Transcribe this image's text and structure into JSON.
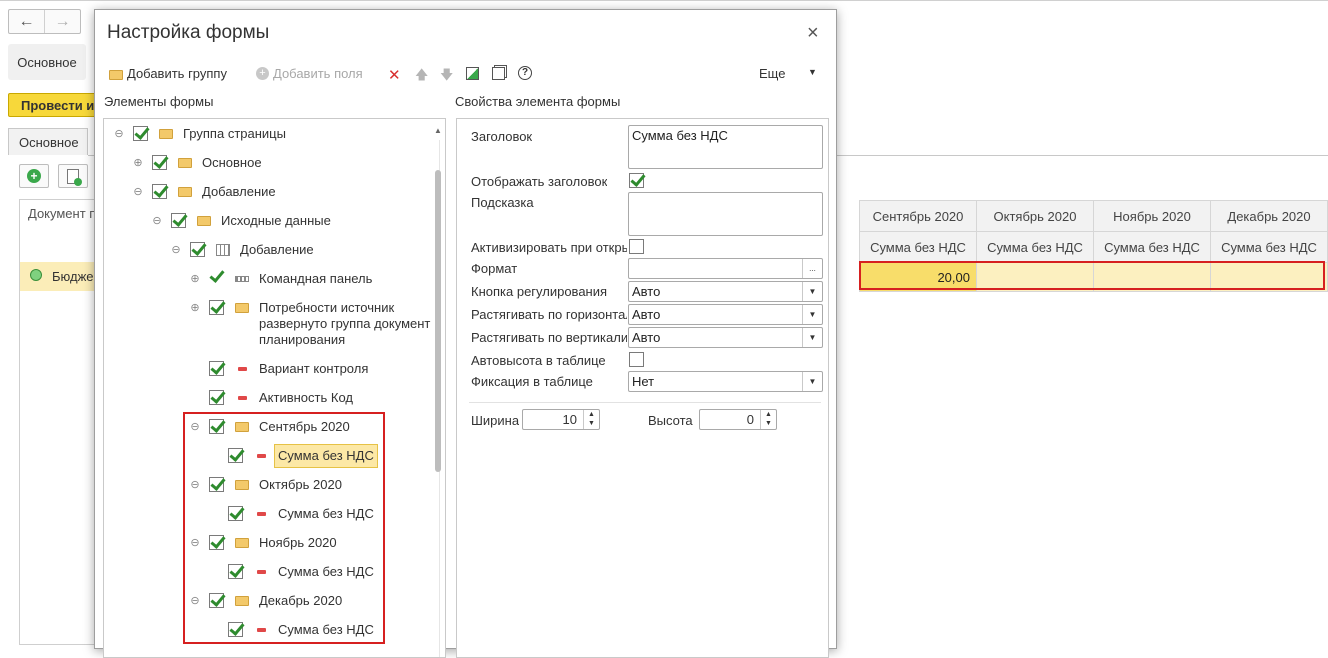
{
  "background": {
    "nav": {
      "back": "←",
      "forward": "→"
    },
    "main_tab": "Основное",
    "post_button": "Провести и",
    "sub_tab": "Основное",
    "grid_header_doc": "Документ п",
    "row_text": "Бюдже",
    "months": [
      "Сентябрь 2020",
      "Октябрь 2020",
      "Ноябрь 2020",
      "Декабрь 2020"
    ],
    "sub_header": [
      "Сумма без НДС",
      "Сумма без НДС",
      "Сумма без НДС",
      "Сумма без НДС"
    ],
    "values": [
      "20,00",
      "",
      "",
      ""
    ]
  },
  "dialog": {
    "title": "Настройка формы",
    "close": "×",
    "toolbar": {
      "add_group": "Добавить группу",
      "add_fields": "Добавить поля",
      "more": "Еще",
      "delete_glyph": "✕",
      "up_glyph": "🡅",
      "down_glyph": "🡇",
      "help_glyph": "?"
    },
    "left_section": "Элементы формы",
    "right_section": "Свойства элемента формы",
    "tree": [
      {
        "label": "Группа страницы"
      },
      {
        "label": "Основное"
      },
      {
        "label": "Добавление"
      },
      {
        "label": "Исходные данные"
      },
      {
        "label": "Добавление"
      },
      {
        "label": "Командная панель"
      },
      {
        "label": "Потребности источник развернуто группа документ планирования"
      },
      {
        "label": "Вариант контроля"
      },
      {
        "label": "Активность Код"
      },
      {
        "label": "Сентябрь 2020"
      },
      {
        "label": "Сумма без НДС"
      },
      {
        "label": "Октябрь 2020"
      },
      {
        "label": "Сумма без НДС"
      },
      {
        "label": "Ноябрь 2020"
      },
      {
        "label": "Сумма без НДС"
      },
      {
        "label": "Декабрь 2020"
      },
      {
        "label": "Сумма без НДС"
      }
    ],
    "props": {
      "title_label": "Заголовок",
      "title_value": "Сумма без НДС",
      "show_title_label": "Отображать заголовок",
      "hint_label": "Подсказка",
      "activate_label": "Активизировать при откры",
      "format_label": "Формат",
      "format_button": "...",
      "adjust_button_label": "Кнопка регулирования",
      "adjust_button_value": "Авто",
      "stretch_h_label": "Растягивать по горизонтали",
      "stretch_h_value": "Авто",
      "stretch_v_label": "Растягивать по вертикали",
      "stretch_v_value": "Авто",
      "autoheight_label": "Автовысота в таблице",
      "fixation_label": "Фиксация в таблице",
      "fixation_value": "Нет",
      "width_label": "Ширина",
      "width_value": "10",
      "height_label": "Высота",
      "height_value": "0"
    }
  }
}
